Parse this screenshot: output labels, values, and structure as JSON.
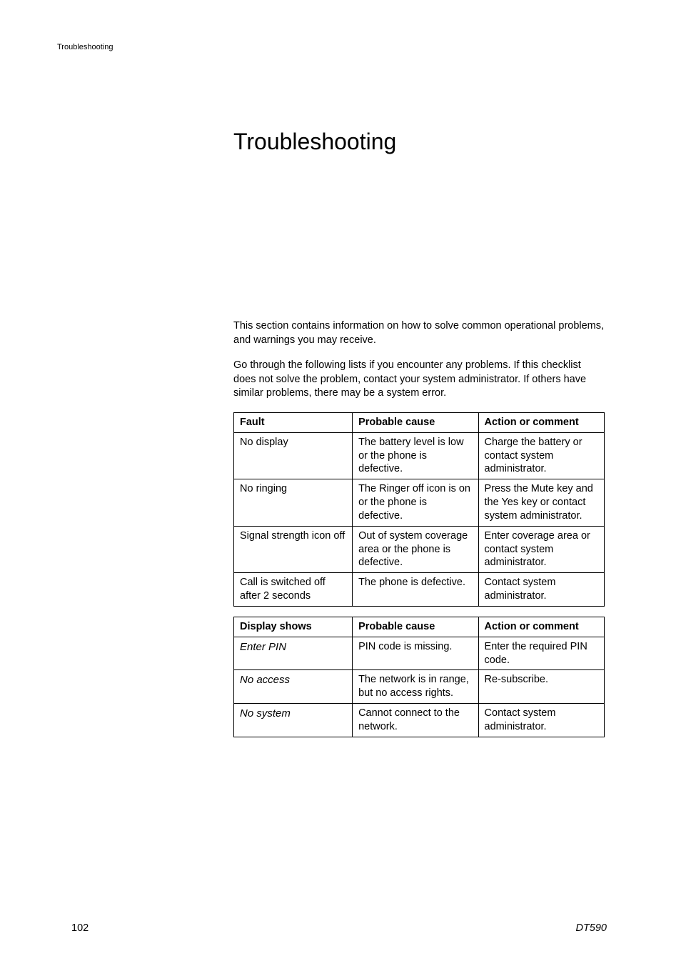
{
  "runningHeader": "Troubleshooting",
  "title": "Troubleshooting",
  "para1": "This section contains information on how to solve common operational problems, and warnings you may receive.",
  "para2": "Go through the following lists if you encounter any problems. If this checklist does not solve the problem, contact your system administrator. If others have similar problems, there may be a system error.",
  "table1": {
    "headers": {
      "h1": "Fault",
      "h2": "Probable cause",
      "h3": "Action or comment"
    },
    "rows": {
      "r1": {
        "c1": "No display",
        "c2": "The battery level is low or the phone is defective.",
        "c3": "Charge the battery or contact system administrator."
      },
      "r2": {
        "c1": "No ringing",
        "c2": "The Ringer off icon is on or the phone is defective.",
        "c3": "Press the Mute key and the Yes key or contact system administrator."
      },
      "r3": {
        "c1": "Signal strength icon off",
        "c2": "Out of system coverage area or the phone is defective.",
        "c3": "Enter coverage area or contact system administrator."
      },
      "r4": {
        "c1": "Call is switched off after 2 seconds",
        "c2": "The phone is defective.",
        "c3": "Contact system administrator."
      }
    }
  },
  "table2": {
    "headers": {
      "h1": "Display shows",
      "h2": "Probable cause",
      "h3": "Action or comment"
    },
    "rows": {
      "r1": {
        "c1": "Enter PIN",
        "c2": "PIN code is missing.",
        "c3": "Enter the required PIN code."
      },
      "r2": {
        "c1": "No access",
        "c2": "The network is in range, but no access rights.",
        "c3": "Re-subscribe."
      },
      "r3": {
        "c1": "No system",
        "c2": "Cannot connect to the network.",
        "c3": "Contact system administrator."
      }
    }
  },
  "footer": {
    "pageNumber": "102",
    "docId": "DT590"
  }
}
